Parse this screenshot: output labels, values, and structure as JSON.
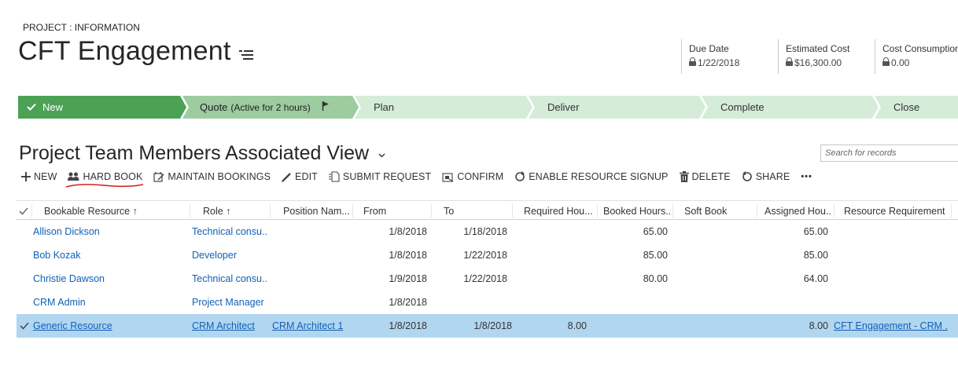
{
  "header": {
    "entity_label": "PROJECT : INFORMATION",
    "title": "CFT Engagement",
    "fields": [
      {
        "label": "Due Date",
        "value": "1/22/2018"
      },
      {
        "label": "Estimated Cost",
        "value": "$16,300.00"
      },
      {
        "label": "Cost Consumption",
        "value": "0.00"
      }
    ]
  },
  "process": {
    "stages": [
      {
        "label": "New",
        "extra": ""
      },
      {
        "label": "Quote",
        "extra": "(Active for 2 hours)"
      },
      {
        "label": "Plan",
        "extra": ""
      },
      {
        "label": "Deliver",
        "extra": ""
      },
      {
        "label": "Complete",
        "extra": ""
      },
      {
        "label": "Close",
        "extra": ""
      }
    ]
  },
  "view": {
    "title": "Project Team Members Associated View",
    "search_placeholder": "Search for records"
  },
  "toolbar": {
    "new": "NEW",
    "hard_book": "HARD BOOK",
    "maintain_bookings": "MAINTAIN BOOKINGS",
    "edit": "EDIT",
    "submit_request": "SUBMIT REQUEST",
    "confirm": "CONFIRM",
    "enable_signup": "ENABLE RESOURCE SIGNUP",
    "delete": "DELETE",
    "share": "SHARE",
    "more": "•••"
  },
  "grid": {
    "columns": [
      "Bookable Resource ↑",
      "Role ↑",
      "Position Nam...",
      "From",
      "To",
      "Required Hou...",
      "Booked Hours...",
      "Soft Book",
      "Assigned Hou...",
      "Resource Requirement"
    ],
    "rows": [
      {
        "resource": "Allison Dickson",
        "role": "Technical consu...",
        "position": "",
        "from": "1/8/2018",
        "to": "1/18/2018",
        "required": "",
        "booked": "65.00",
        "soft": "",
        "assigned": "65.00",
        "requirement": ""
      },
      {
        "resource": "Bob Kozak",
        "role": "Developer",
        "position": "",
        "from": "1/8/2018",
        "to": "1/22/2018",
        "required": "",
        "booked": "85.00",
        "soft": "",
        "assigned": "85.00",
        "requirement": ""
      },
      {
        "resource": "Christie Dawson",
        "role": "Technical consu...",
        "position": "",
        "from": "1/9/2018",
        "to": "1/22/2018",
        "required": "",
        "booked": "80.00",
        "soft": "",
        "assigned": "64.00",
        "requirement": ""
      },
      {
        "resource": "CRM Admin",
        "role": "Project Manager",
        "position": "",
        "from": "1/8/2018",
        "to": "",
        "required": "",
        "booked": "",
        "soft": "",
        "assigned": "",
        "requirement": ""
      },
      {
        "resource": "Generic Resource",
        "role": "CRM Architect",
        "position": "CRM Architect 1",
        "from": "1/8/2018",
        "to": "1/8/2018",
        "required": "8.00",
        "booked": "",
        "soft": "",
        "assigned": "8.00",
        "requirement": "CFT Engagement - CRM ..."
      }
    ]
  },
  "colors": {
    "stage_done": "#4ca155",
    "stage_active": "#9ccc9f",
    "stage_pending": "#d4ecd8",
    "selected_row": "#b1d6f0",
    "link": "#1160b7"
  }
}
